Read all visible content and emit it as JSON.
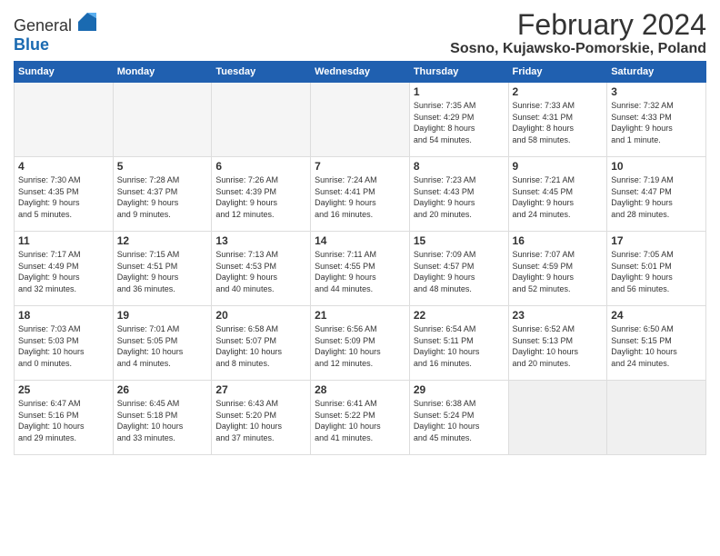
{
  "header": {
    "logo_general": "General",
    "logo_blue": "Blue",
    "month_year": "February 2024",
    "location": "Sosno, Kujawsko-Pomorskie, Poland"
  },
  "weekdays": [
    "Sunday",
    "Monday",
    "Tuesday",
    "Wednesday",
    "Thursday",
    "Friday",
    "Saturday"
  ],
  "weeks": [
    [
      {
        "day": "",
        "info": ""
      },
      {
        "day": "",
        "info": ""
      },
      {
        "day": "",
        "info": ""
      },
      {
        "day": "",
        "info": ""
      },
      {
        "day": "1",
        "info": "Sunrise: 7:35 AM\nSunset: 4:29 PM\nDaylight: 8 hours\nand 54 minutes."
      },
      {
        "day": "2",
        "info": "Sunrise: 7:33 AM\nSunset: 4:31 PM\nDaylight: 8 hours\nand 58 minutes."
      },
      {
        "day": "3",
        "info": "Sunrise: 7:32 AM\nSunset: 4:33 PM\nDaylight: 9 hours\nand 1 minute."
      }
    ],
    [
      {
        "day": "4",
        "info": "Sunrise: 7:30 AM\nSunset: 4:35 PM\nDaylight: 9 hours\nand 5 minutes."
      },
      {
        "day": "5",
        "info": "Sunrise: 7:28 AM\nSunset: 4:37 PM\nDaylight: 9 hours\nand 9 minutes."
      },
      {
        "day": "6",
        "info": "Sunrise: 7:26 AM\nSunset: 4:39 PM\nDaylight: 9 hours\nand 12 minutes."
      },
      {
        "day": "7",
        "info": "Sunrise: 7:24 AM\nSunset: 4:41 PM\nDaylight: 9 hours\nand 16 minutes."
      },
      {
        "day": "8",
        "info": "Sunrise: 7:23 AM\nSunset: 4:43 PM\nDaylight: 9 hours\nand 20 minutes."
      },
      {
        "day": "9",
        "info": "Sunrise: 7:21 AM\nSunset: 4:45 PM\nDaylight: 9 hours\nand 24 minutes."
      },
      {
        "day": "10",
        "info": "Sunrise: 7:19 AM\nSunset: 4:47 PM\nDaylight: 9 hours\nand 28 minutes."
      }
    ],
    [
      {
        "day": "11",
        "info": "Sunrise: 7:17 AM\nSunset: 4:49 PM\nDaylight: 9 hours\nand 32 minutes."
      },
      {
        "day": "12",
        "info": "Sunrise: 7:15 AM\nSunset: 4:51 PM\nDaylight: 9 hours\nand 36 minutes."
      },
      {
        "day": "13",
        "info": "Sunrise: 7:13 AM\nSunset: 4:53 PM\nDaylight: 9 hours\nand 40 minutes."
      },
      {
        "day": "14",
        "info": "Sunrise: 7:11 AM\nSunset: 4:55 PM\nDaylight: 9 hours\nand 44 minutes."
      },
      {
        "day": "15",
        "info": "Sunrise: 7:09 AM\nSunset: 4:57 PM\nDaylight: 9 hours\nand 48 minutes."
      },
      {
        "day": "16",
        "info": "Sunrise: 7:07 AM\nSunset: 4:59 PM\nDaylight: 9 hours\nand 52 minutes."
      },
      {
        "day": "17",
        "info": "Sunrise: 7:05 AM\nSunset: 5:01 PM\nDaylight: 9 hours\nand 56 minutes."
      }
    ],
    [
      {
        "day": "18",
        "info": "Sunrise: 7:03 AM\nSunset: 5:03 PM\nDaylight: 10 hours\nand 0 minutes."
      },
      {
        "day": "19",
        "info": "Sunrise: 7:01 AM\nSunset: 5:05 PM\nDaylight: 10 hours\nand 4 minutes."
      },
      {
        "day": "20",
        "info": "Sunrise: 6:58 AM\nSunset: 5:07 PM\nDaylight: 10 hours\nand 8 minutes."
      },
      {
        "day": "21",
        "info": "Sunrise: 6:56 AM\nSunset: 5:09 PM\nDaylight: 10 hours\nand 12 minutes."
      },
      {
        "day": "22",
        "info": "Sunrise: 6:54 AM\nSunset: 5:11 PM\nDaylight: 10 hours\nand 16 minutes."
      },
      {
        "day": "23",
        "info": "Sunrise: 6:52 AM\nSunset: 5:13 PM\nDaylight: 10 hours\nand 20 minutes."
      },
      {
        "day": "24",
        "info": "Sunrise: 6:50 AM\nSunset: 5:15 PM\nDaylight: 10 hours\nand 24 minutes."
      }
    ],
    [
      {
        "day": "25",
        "info": "Sunrise: 6:47 AM\nSunset: 5:16 PM\nDaylight: 10 hours\nand 29 minutes."
      },
      {
        "day": "26",
        "info": "Sunrise: 6:45 AM\nSunset: 5:18 PM\nDaylight: 10 hours\nand 33 minutes."
      },
      {
        "day": "27",
        "info": "Sunrise: 6:43 AM\nSunset: 5:20 PM\nDaylight: 10 hours\nand 37 minutes."
      },
      {
        "day": "28",
        "info": "Sunrise: 6:41 AM\nSunset: 5:22 PM\nDaylight: 10 hours\nand 41 minutes."
      },
      {
        "day": "29",
        "info": "Sunrise: 6:38 AM\nSunset: 5:24 PM\nDaylight: 10 hours\nand 45 minutes."
      },
      {
        "day": "",
        "info": ""
      },
      {
        "day": "",
        "info": ""
      }
    ]
  ]
}
